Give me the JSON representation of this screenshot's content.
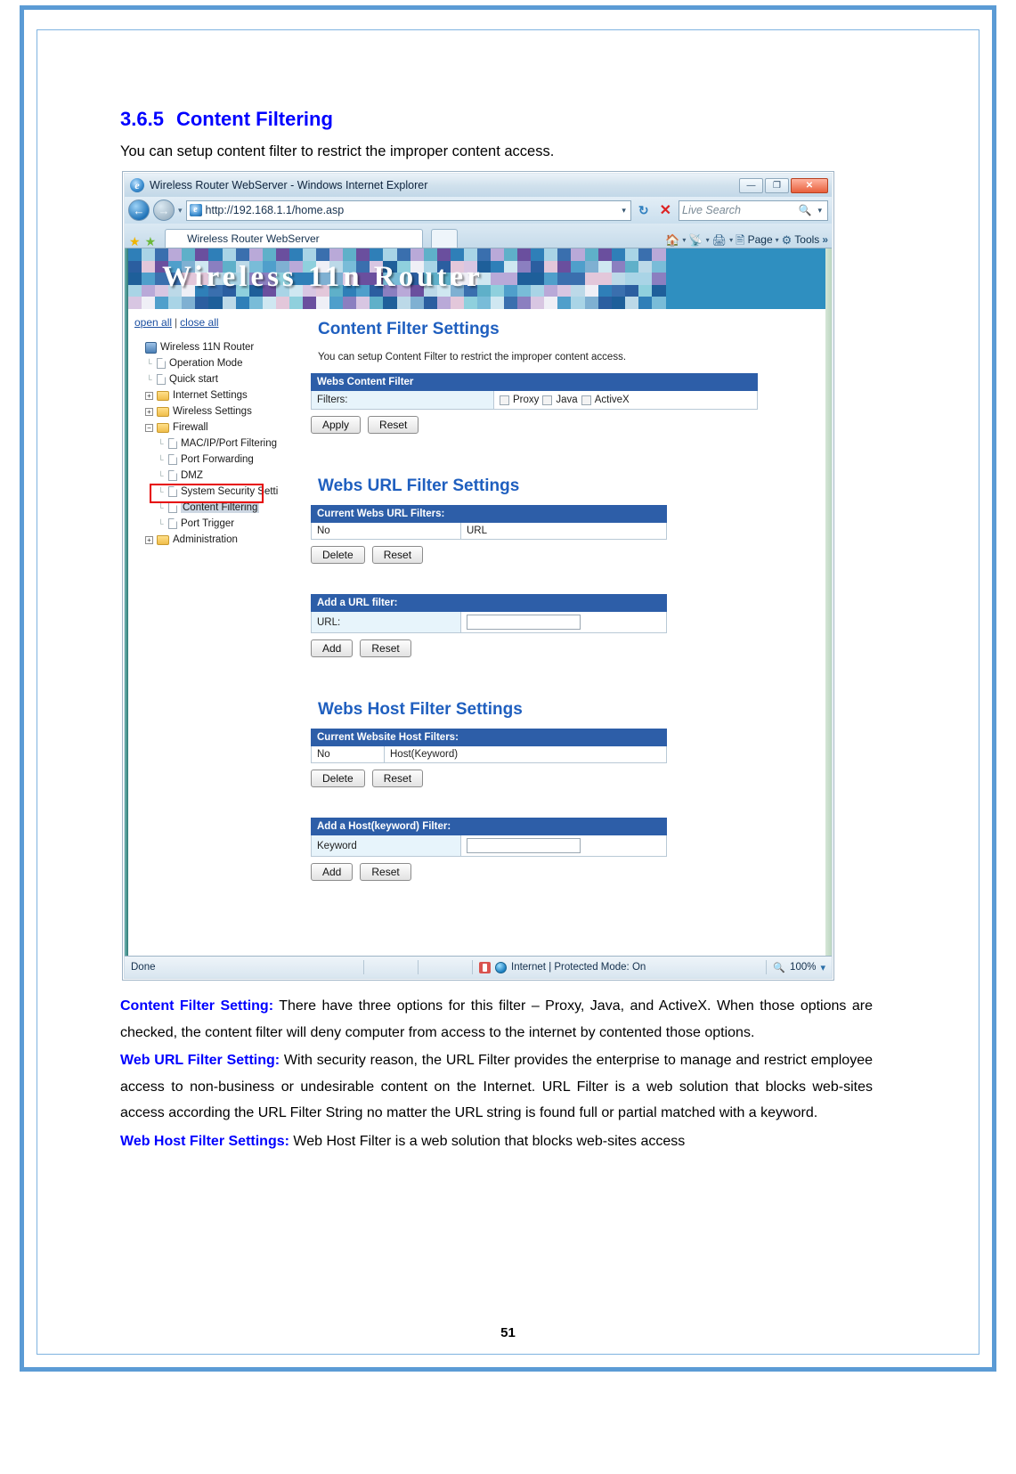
{
  "document": {
    "section_number": "3.6.5",
    "section_title": "Content Filtering",
    "intro": "You can setup content filter to restrict the improper content access.",
    "page_number": "51",
    "paragraphs": [
      {
        "lead": "Content Filter Setting:",
        "text": " There have three options for this filter – Proxy, Java, and ActiveX. When those options are checked, the content filter will deny computer from access to the internet by contented those options."
      },
      {
        "lead": "Web URL Filter Setting:",
        "text": " With security reason, the URL Filter provides the enterprise to manage and restrict employee access to non-business or undesirable content on the Internet. URL Filter is a web solution that blocks web-sites access according the URL Filter String no matter the URL string is found full or partial matched with a keyword."
      },
      {
        "lead": "Web Host Filter Settings:",
        "text": " Web Host Filter is a web solution that blocks web-sites access"
      }
    ]
  },
  "browser": {
    "window_title": "Wireless Router WebServer - Windows Internet Explorer",
    "minimize_label": "—",
    "maximize_label": "❐",
    "close_label": "✕",
    "url": "http://192.168.1.1/home.asp",
    "search_placeholder": "Live Search",
    "tab_title": "Wireless Router WebServer",
    "toolbar": {
      "page_label": "Page",
      "tools_label": "Tools",
      "overflow_label": "»"
    },
    "statusbar": {
      "left": "Done",
      "zone": "Internet | Protected Mode: On",
      "zoom": "100%",
      "zoom_caret": "▾"
    }
  },
  "router_ui": {
    "banner_title": "Wireless 11n Router",
    "tree_controls": {
      "open_all": "open all",
      "separator": "|",
      "close_all": "close all"
    },
    "tree": [
      {
        "label": "Wireless 11N Router",
        "icon": "router-icon",
        "level": 0,
        "toggle": "none",
        "selected": false
      },
      {
        "label": "Operation Mode",
        "icon": "page-icon",
        "level": 1,
        "toggle": "none",
        "selected": false
      },
      {
        "label": "Quick start",
        "icon": "page-icon",
        "level": 1,
        "toggle": "none",
        "selected": false
      },
      {
        "label": "Internet Settings",
        "icon": "folder-icon",
        "level": 1,
        "toggle": "plus",
        "selected": false
      },
      {
        "label": "Wireless Settings",
        "icon": "folder-icon",
        "level": 1,
        "toggle": "plus",
        "selected": false
      },
      {
        "label": "Firewall",
        "icon": "folder-icon",
        "level": 1,
        "toggle": "minus",
        "selected": false
      },
      {
        "label": "MAC/IP/Port Filtering",
        "icon": "page-icon",
        "level": 2,
        "toggle": "none",
        "selected": false
      },
      {
        "label": "Port Forwarding",
        "icon": "page-icon",
        "level": 2,
        "toggle": "none",
        "selected": false
      },
      {
        "label": "DMZ",
        "icon": "page-icon",
        "level": 2,
        "toggle": "none",
        "selected": false
      },
      {
        "label": "System Security Setti",
        "icon": "page-icon",
        "level": 2,
        "toggle": "none",
        "selected": false
      },
      {
        "label": "Content Filtering",
        "icon": "page-icon",
        "level": 2,
        "toggle": "none",
        "selected": true
      },
      {
        "label": "Port Trigger",
        "icon": "page-icon",
        "level": 2,
        "toggle": "none",
        "selected": false
      },
      {
        "label": "Administration",
        "icon": "folder-icon",
        "level": 1,
        "toggle": "plus",
        "selected": false
      }
    ],
    "content_filter": {
      "title": "Content Filter Settings",
      "description": "You can setup Content Filter to restrict the improper content access.",
      "table_header": "Webs Content Filter",
      "filters_label": "Filters:",
      "checkboxes": [
        {
          "label": "Proxy",
          "checked": false
        },
        {
          "label": "Java",
          "checked": false
        },
        {
          "label": "ActiveX",
          "checked": false
        }
      ],
      "apply_label": "Apply",
      "reset_label": "Reset"
    },
    "url_filter": {
      "title": "Webs URL Filter Settings",
      "current_header": "Current Webs URL Filters:",
      "col_no": "No",
      "col_url": "URL",
      "delete_label": "Delete",
      "reset_label": "Reset",
      "add_header": "Add a URL filter:",
      "url_label": "URL:",
      "url_value": "",
      "add_label": "Add",
      "add_reset_label": "Reset"
    },
    "host_filter": {
      "title": "Webs Host Filter Settings",
      "current_header": "Current Website Host Filters:",
      "col_no": "No",
      "col_host": "Host(Keyword)",
      "delete_label": "Delete",
      "reset_label": "Reset",
      "add_header": "Add a Host(keyword) Filter:",
      "keyword_label": "Keyword",
      "keyword_value": "",
      "add_label": "Add",
      "add_reset_label": "Reset"
    }
  },
  "colors": {
    "heading_blue": "#0000ff",
    "panel_blue": "#1f5fbf",
    "table_header_blue": "#2d5ea8",
    "highlight_red": "#e60000",
    "label_bg": "#e7f4fb"
  }
}
